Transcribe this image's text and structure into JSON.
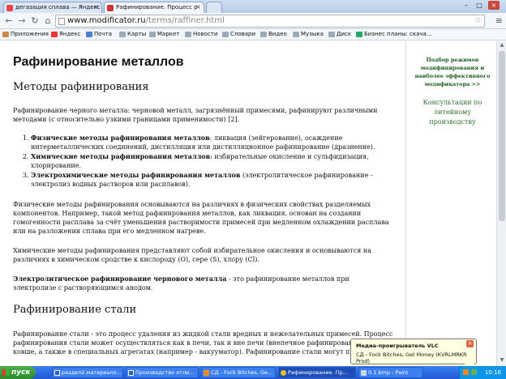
{
  "browser": {
    "tabs": [
      {
        "label": "дегазация сплава — Яндекс",
        "active": false
      },
      {
        "label": "Рафинирование. Процесс р",
        "active": true
      }
    ],
    "address": {
      "host": "www.modificator.ru",
      "path": "/terms/raffiner.html"
    },
    "bookmarks": [
      "Приложения",
      "Яндекс",
      "Почта",
      "Карты",
      "Маркет",
      "Новости",
      "Словари",
      "Видео",
      "Музыка",
      "Диск",
      "Бизнес планы: скача..."
    ]
  },
  "article": {
    "title": "Рафинирование металлов",
    "section1": "Методы рафинирования",
    "intro": "Рафинирование черного металла: черновой металл, загрязнённый примесями, рафинируют различными методами (с относительно узкими границами применимости) [2].",
    "methods": [
      {
        "bold": "Физические методы рафинирования металлов",
        "text": ": ликвация (зейгерование), осаждение интерметаллических соединений, дистилляция или дистилляционное рафинирование (дразнение)."
      },
      {
        "bold": "Химические методы рафинирования металлов",
        "text": ": избирательные окисление и сульфидизация, хлорирование."
      },
      {
        "bold": "Электрохимические методы рафинирования металлов",
        "text": " (электролитическое рафинирование - электролиз водных растворов или расплавов)."
      }
    ],
    "physical": "Физические методы рафинирования основываются на различиях в физических свойствах разделяемых компонентов. Например, такой метод рафинирования металлов, как ликвация, основан на создании гомогенности расплава за счёт уменьшения растворимости примесей при медленном охлаждении расплава или на разложении сплава при его медленном нагреве.",
    "chemical": "Химические методы рафинирования представляют собой избирательное окисления и основываются на различиях в химическом сродстве к кислороду (O), сере (S), хлору (Cl).",
    "electro_bold": "Электролитическое рафинирование чернового металла",
    "electro_text": " - это рафинирование металлов при электролизе с растворяющимся анодом.",
    "section2": "Рафинирование стали",
    "steel": "Рафинирование стали - это процесс удаления из жидкой стали вредных и нежелательных примесей. Процесс рафинирования стали может осуществляться как в печи, так и вне печи (внепечное рафинирование стали в ковше, а также в специальных агрегатах (например - вакууматор). Рафинирование стали могут провод"
  },
  "sidebar": {
    "link": "Подбор режимов модифицирования и наиболее эффективного модификатора >>",
    "consult": "Консультации по литейному производству"
  },
  "vlc": {
    "title": "Медиа-проигрыватель VLC",
    "track": "СД - Fock Bitches, Get Money (KVRLMRKR Prod)"
  },
  "taskbar": {
    "start": "пуск",
    "tasks": [
      {
        "label": "раздел2.материало...",
        "active": false
      },
      {
        "label": "Производство отли...",
        "active": false
      },
      {
        "label": "СД - Fock Bitches, Ge...",
        "active": false
      },
      {
        "label": "Рафинирование. Пр...",
        "active": true
      },
      {
        "label": "0.1.bmp - Paint",
        "active": false
      }
    ],
    "clock": "10:16"
  },
  "colors": {
    "sidebar_link": "#1a5c1a",
    "taskbar": "#245edb",
    "start": "#3c9a3c"
  }
}
